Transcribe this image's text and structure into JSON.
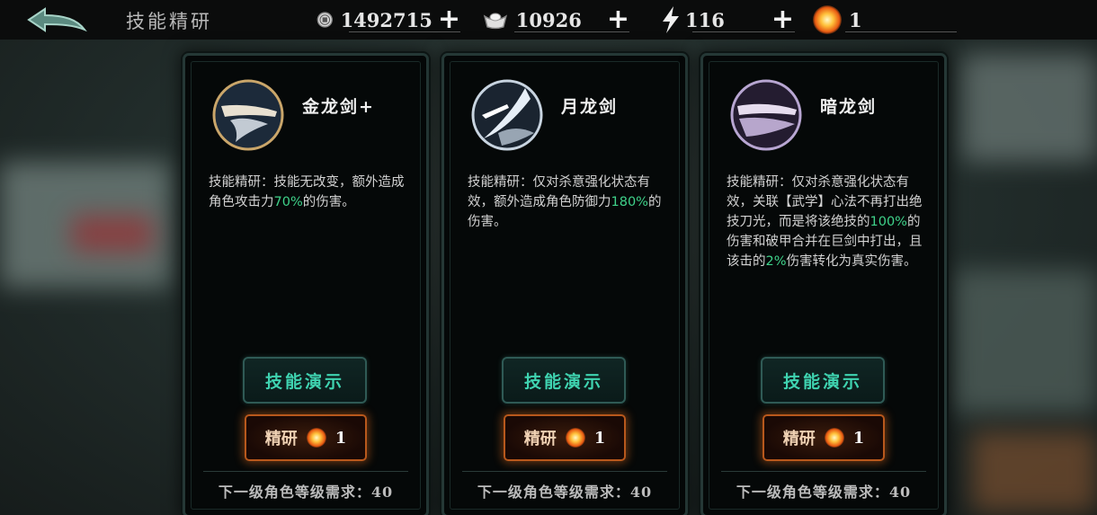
{
  "header": {
    "title": "技能精研",
    "resources": [
      {
        "name": "coin",
        "value": "1492715",
        "icon": "coin-icon"
      },
      {
        "name": "silver",
        "value": "10926",
        "icon": "silver-ingot-icon"
      },
      {
        "name": "stamina",
        "value": "116",
        "icon": "lightning-icon"
      },
      {
        "name": "refine-token",
        "value": "1",
        "icon": "fire-orb-icon"
      }
    ],
    "plus_label": "+"
  },
  "cards": [
    {
      "name": "金龙剑+",
      "description": [
        "技能精研：技能无改变，额外造成角色攻击力",
        "70%",
        "的伤害。"
      ],
      "demo_label": "技能演示",
      "refine_label": "精研",
      "refine_cost": "1",
      "requirement": "下一级角色等级需求：40",
      "icon_tint": "#caa66a"
    },
    {
      "name": "月龙剑",
      "description": [
        "技能精研：仅对杀意强化状态有效，额外造成角色防御力",
        "180%",
        "的伤害。"
      ],
      "demo_label": "技能演示",
      "refine_label": "精研",
      "refine_cost": "1",
      "requirement": "下一级角色等级需求：40",
      "icon_tint": "#c8d4e0"
    },
    {
      "name": "暗龙剑",
      "description": [
        "技能精研：仅对杀意强化状态有效，关联【武学】心法不再打出绝技刀光，而是将该绝技的",
        "100%",
        "的伤害和破甲合并在巨剑中打出，且该击的",
        "2%",
        "伤害转化为真实伤害。"
      ],
      "demo_label": "技能演示",
      "refine_label": "精研",
      "refine_cost": "1",
      "requirement": "下一级角色等级需求：40",
      "icon_tint": "#b8a6d2"
    }
  ],
  "colors": {
    "highlight": "#3fd28a",
    "demo_text": "#3fd3b0",
    "refine_glow": "#e86e1e"
  }
}
